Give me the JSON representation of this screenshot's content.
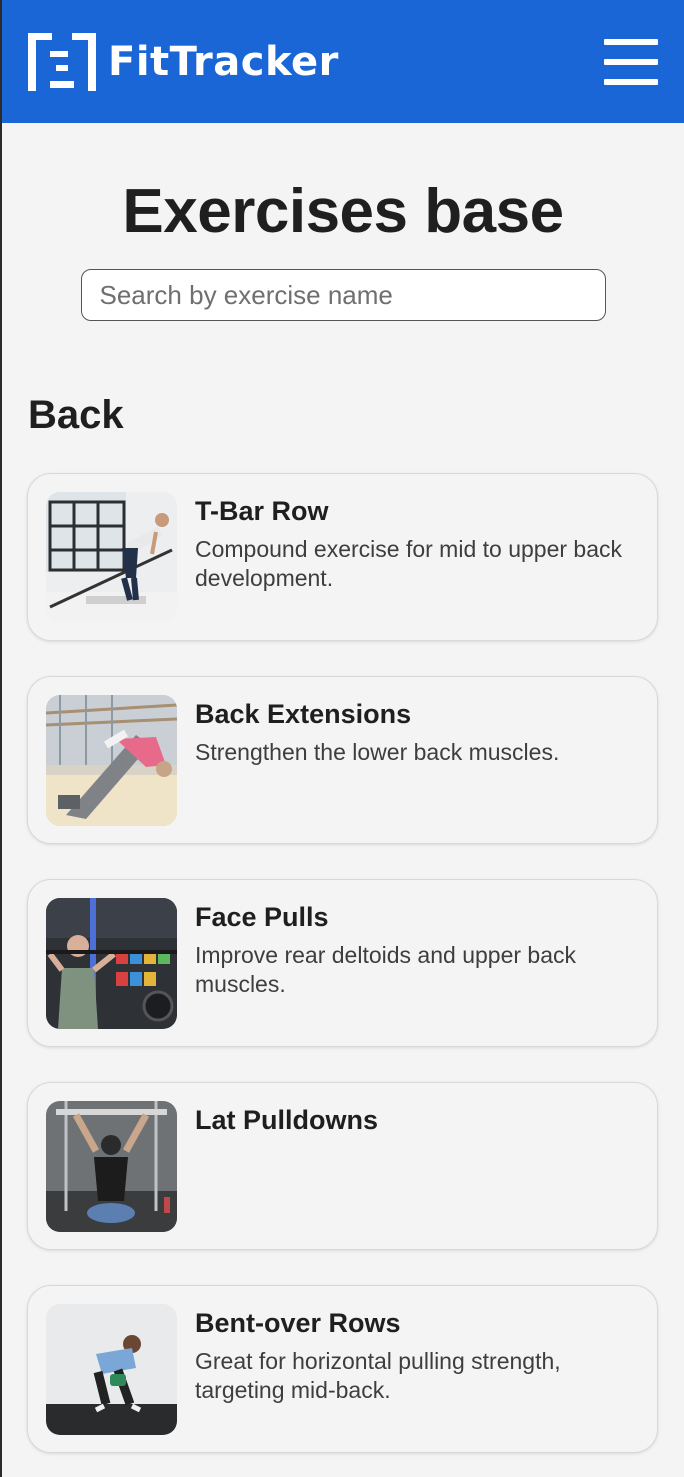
{
  "header": {
    "brand_name": "FitTracker"
  },
  "page": {
    "title": "Exercises base"
  },
  "search": {
    "placeholder": "Search by exercise name",
    "value": ""
  },
  "section": {
    "title": "Back"
  },
  "exercises": [
    {
      "title": "T-Bar Row",
      "description": "Compound exercise for mid to upper back development."
    },
    {
      "title": "Back Extensions",
      "description": "Strengthen the lower back muscles."
    },
    {
      "title": "Face Pulls",
      "description": "Improve rear deltoids and upper back muscles."
    },
    {
      "title": "Lat Pulldowns",
      "description": ""
    },
    {
      "title": "Bent-over Rows",
      "description": "Great for horizontal pulling strength, targeting mid-back."
    }
  ],
  "colors": {
    "header_bg": "#1a66d6",
    "page_bg": "#f4f4f4",
    "text": "#1f1f1f"
  },
  "icons": {
    "brand": "fittracker-logo-icon",
    "menu": "hamburger-menu-icon"
  }
}
